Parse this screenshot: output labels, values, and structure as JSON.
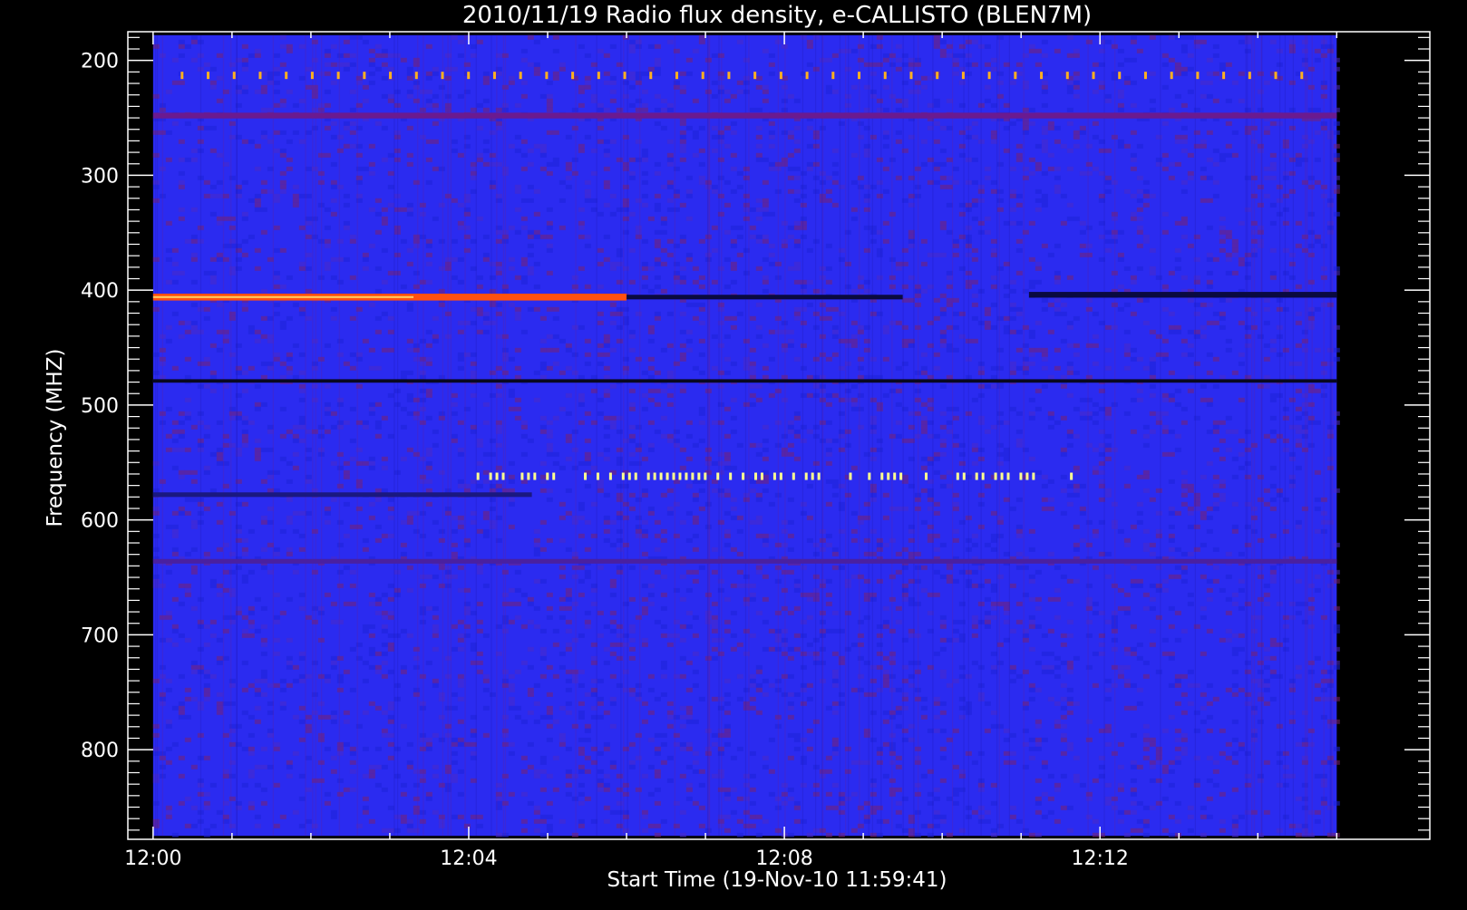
{
  "chart_data": {
    "type": "heatmap",
    "title": "2010/11/19  Radio flux density, e-CALLISTO (BLEN7M)",
    "xlabel": "Start Time (19-Nov-10 11:59:41)",
    "ylabel": "Frequency (MHZ)",
    "x_ticks": [
      "12:00",
      "12:04",
      "12:08",
      "12:12"
    ],
    "x_tick_minutes": [
      0,
      4,
      8,
      12
    ],
    "y_ticks": [
      200,
      300,
      400,
      500,
      600,
      700,
      800
    ],
    "xlim_minutes": [
      -0.32,
      16.18
    ],
    "ylim_mhz": [
      175,
      878
    ],
    "data_extent": {
      "x_minutes": [
        0.0,
        15.0
      ],
      "y_mhz": [
        178,
        875
      ]
    },
    "y_inverted": true,
    "colormap": [
      "#000000",
      "#1a10a6",
      "#2a2aff",
      "#5a2ed8",
      "#a01818",
      "#ff2200",
      "#ff8800",
      "#ffff80"
    ],
    "background_color": "#2b2bf0",
    "features": [
      {
        "kind": "band",
        "freq_mhz": 406,
        "width_mhz": 6,
        "t_start": 0.0,
        "t_end": 6.0,
        "color": "#ff5010"
      },
      {
        "kind": "band",
        "freq_mhz": 406,
        "width_mhz": 4,
        "t_start": 6.0,
        "t_end": 9.5,
        "color": "#0a0a40"
      },
      {
        "kind": "band",
        "freq_mhz": 404,
        "width_mhz": 5,
        "t_start": 11.1,
        "t_end": 15.0,
        "color": "#0a0a40"
      },
      {
        "kind": "band",
        "freq_mhz": 479,
        "width_mhz": 3,
        "t_start": 0.0,
        "t_end": 15.0,
        "color": "#080820"
      },
      {
        "kind": "band",
        "freq_mhz": 248,
        "width_mhz": 5,
        "t_start": 0.0,
        "t_end": 15.0,
        "color": "#6a1a90"
      },
      {
        "kind": "band",
        "freq_mhz": 578,
        "width_mhz": 4,
        "t_start": 0.0,
        "t_end": 4.8,
        "color": "#1a1880"
      },
      {
        "kind": "band",
        "freq_mhz": 636,
        "width_mhz": 4,
        "t_start": 0.0,
        "t_end": 15.0,
        "color": "#4a20a0"
      },
      {
        "kind": "dot_row",
        "freq_mhz": 213,
        "t_start": 0.35,
        "t_end": 14.8,
        "step_min": 0.33,
        "color": "#ffb020"
      },
      {
        "kind": "dot_row",
        "freq_mhz": 562,
        "t_start": 4.1,
        "t_end": 11.8,
        "step_min": 0.08,
        "color": "#ffff90"
      }
    ]
  }
}
